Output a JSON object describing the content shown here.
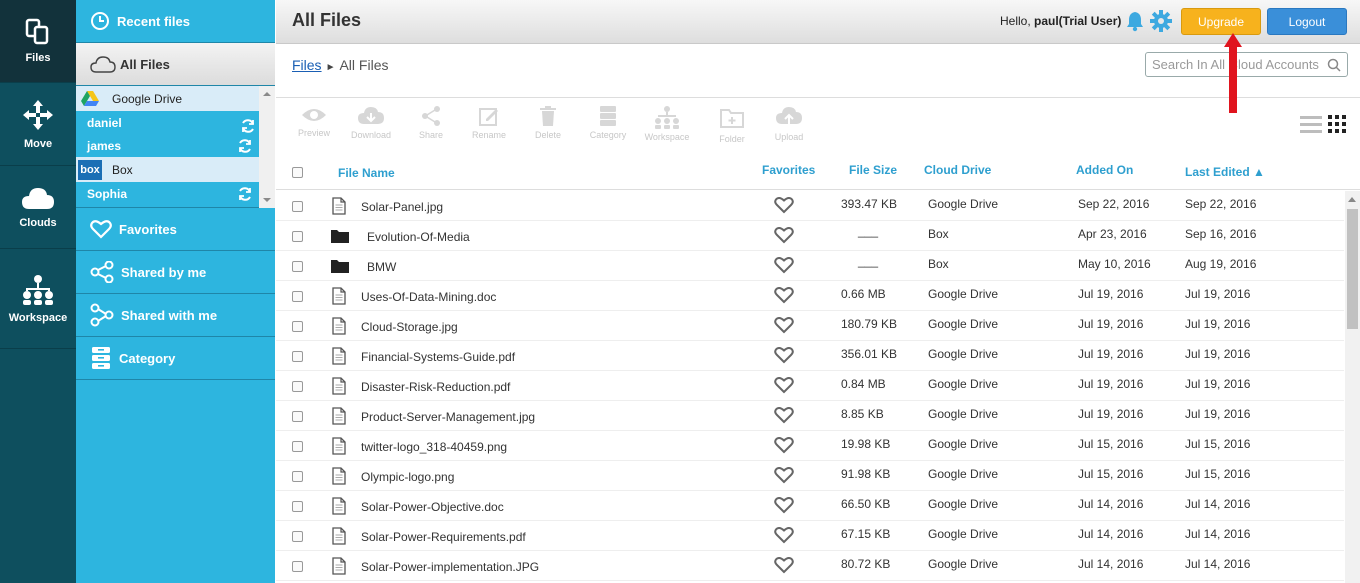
{
  "rail": {
    "items": [
      {
        "label": "Files",
        "icon": "files-icon"
      },
      {
        "label": "Move",
        "icon": "move-icon"
      },
      {
        "label": "Clouds",
        "icon": "clouds-icon"
      },
      {
        "label": "Workspace",
        "icon": "workspace-icon"
      }
    ]
  },
  "sidebar": {
    "recent": "Recent files",
    "all_files": "All Files",
    "favorites": "Favorites",
    "shared_by_me": "Shared by me",
    "shared_with_me": "Shared with me",
    "category": "Category",
    "accounts": [
      {
        "provider": "Google Drive",
        "users": [
          "daniel",
          "james"
        ]
      },
      {
        "provider": "Box",
        "users": [
          "Sophia"
        ]
      }
    ]
  },
  "header": {
    "title": "All Files",
    "hello_prefix": "Hello, ",
    "user": "paul(Trial User)",
    "upgrade": "Upgrade",
    "logout": "Logout"
  },
  "breadcrumb": {
    "root": "Files",
    "separator": "►",
    "current": "All Files"
  },
  "search": {
    "placeholder": "Search In All Cloud Accounts"
  },
  "toolbar": {
    "preview": "Preview",
    "download": "Download",
    "share": "Share",
    "rename": "Rename",
    "delete": "Delete",
    "category": "Category",
    "workspace": "Workspace",
    "folder": "Folder",
    "upload": "Upload"
  },
  "table": {
    "headers": {
      "name": "File Name",
      "favorites": "Favorites",
      "size": "File Size",
      "drive": "Cloud Drive",
      "added": "Added On",
      "edited": "Last Edited ▲"
    },
    "rows": [
      {
        "name": "Solar-Panel.jpg",
        "type": "file",
        "size": "393.47 KB",
        "drive": "Google Drive",
        "added": "Sep 22, 2016",
        "edited": "Sep 22, 2016"
      },
      {
        "name": "Evolution-Of-Media",
        "type": "folder",
        "size": "___",
        "drive": "Box",
        "added": "Apr 23, 2016",
        "edited": "Sep 16, 2016"
      },
      {
        "name": "BMW",
        "type": "folder",
        "size": "___",
        "drive": "Box",
        "added": "May 10, 2016",
        "edited": "Aug 19, 2016"
      },
      {
        "name": "Uses-Of-Data-Mining.doc",
        "type": "file",
        "size": "0.66 MB",
        "drive": "Google Drive",
        "added": "Jul 19, 2016",
        "edited": "Jul 19, 2016"
      },
      {
        "name": "Cloud-Storage.jpg",
        "type": "file",
        "size": "180.79 KB",
        "drive": "Google Drive",
        "added": "Jul 19, 2016",
        "edited": "Jul 19, 2016"
      },
      {
        "name": "Financial-Systems-Guide.pdf",
        "type": "file",
        "size": "356.01 KB",
        "drive": "Google Drive",
        "added": "Jul 19, 2016",
        "edited": "Jul 19, 2016"
      },
      {
        "name": "Disaster-Risk-Reduction.pdf",
        "type": "file",
        "size": "0.84 MB",
        "drive": "Google Drive",
        "added": "Jul 19, 2016",
        "edited": "Jul 19, 2016"
      },
      {
        "name": "Product-Server-Management.jpg",
        "type": "file",
        "size": "8.85 KB",
        "drive": "Google Drive",
        "added": "Jul 19, 2016",
        "edited": "Jul 19, 2016"
      },
      {
        "name": "twitter-logo_318-40459.png",
        "type": "file",
        "size": "19.98 KB",
        "drive": "Google Drive",
        "added": "Jul 15, 2016",
        "edited": "Jul 15, 2016"
      },
      {
        "name": "Olympic-logo.png",
        "type": "file",
        "size": "91.98 KB",
        "drive": "Google Drive",
        "added": "Jul 15, 2016",
        "edited": "Jul 15, 2016"
      },
      {
        "name": "Solar-Power-Objective.doc",
        "type": "file",
        "size": "66.50 KB",
        "drive": "Google Drive",
        "added": "Jul 14, 2016",
        "edited": "Jul 14, 2016"
      },
      {
        "name": "Solar-Power-Requirements.pdf",
        "type": "file",
        "size": "67.15 KB",
        "drive": "Google Drive",
        "added": "Jul 14, 2016",
        "edited": "Jul 14, 2016"
      },
      {
        "name": "Solar-Power-implementation.JPG",
        "type": "file",
        "size": "80.72 KB",
        "drive": "Google Drive",
        "added": "Jul 14, 2016",
        "edited": "Jul 14, 2016"
      }
    ]
  },
  "colors": {
    "rail": "#0e4f5e",
    "sidebar": "#2db5df",
    "accent_header": "#2e9fcf",
    "upgrade": "#f7b21d",
    "logout": "#3a8fd9",
    "annotation_arrow": "#e0141e"
  }
}
